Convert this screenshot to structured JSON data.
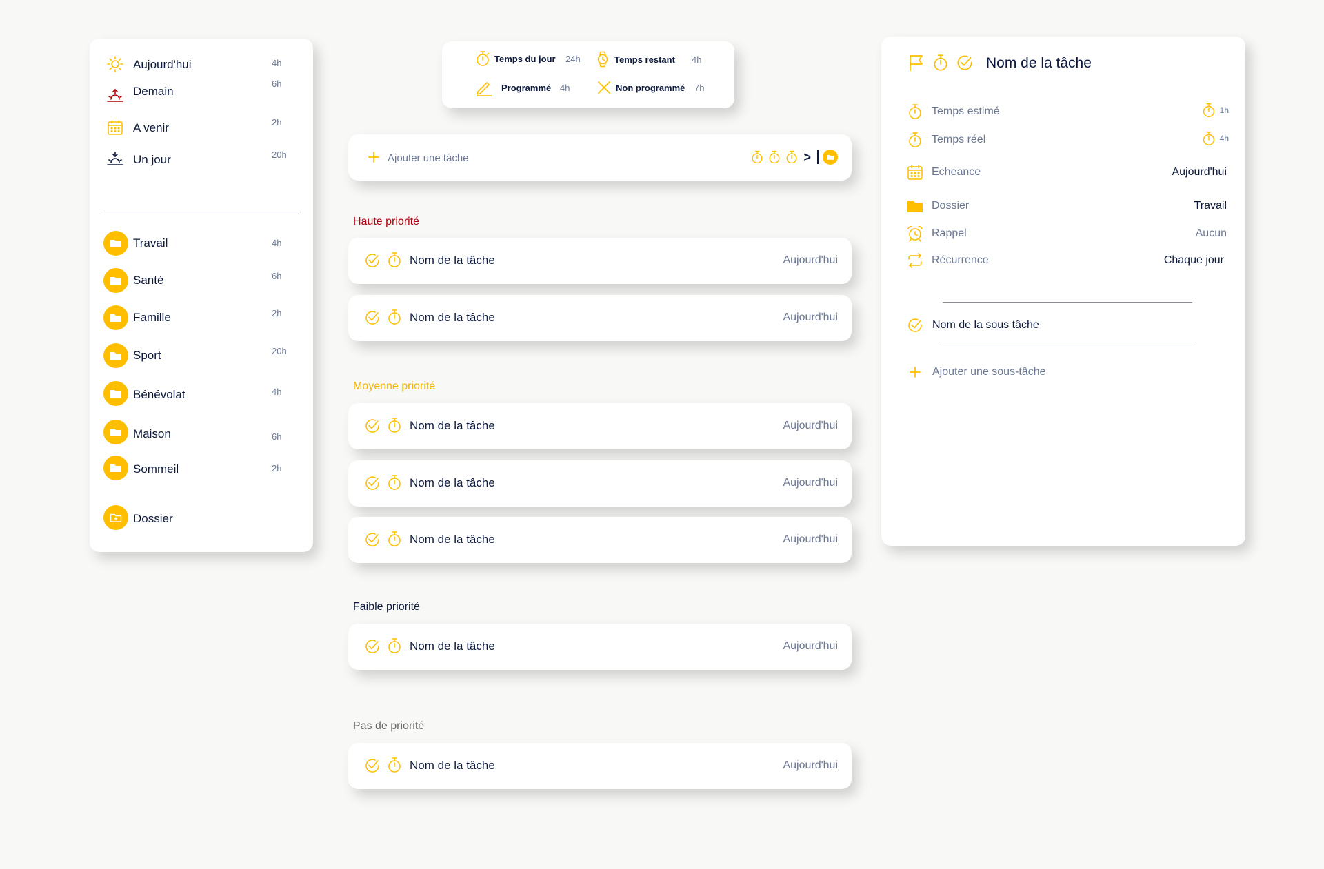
{
  "colors": {
    "accent": "#ffbf00",
    "text": "#0e1a3d",
    "muted": "#6c7894",
    "high_priority": "#b3000c",
    "medium_priority": "#f5b400",
    "low_priority": "#0e1a3d",
    "no_priority": "#6c6c6c"
  },
  "sidebar": {
    "views": [
      {
        "label": "Aujourd'hui",
        "hours": "4h",
        "icon": "sun-icon"
      },
      {
        "label": "Demain",
        "hours": "6h",
        "icon": "sunrise-icon"
      },
      {
        "label": "A venir",
        "hours": "2h",
        "icon": "calendar-icon"
      },
      {
        "label": "Un jour",
        "hours": "20h",
        "icon": "sunset-icon"
      }
    ],
    "folders": [
      {
        "label": "Travail",
        "hours": "4h"
      },
      {
        "label": "Santé",
        "hours": "6h"
      },
      {
        "label": "Famille",
        "hours": "2h"
      },
      {
        "label": "Sport",
        "hours": "20h"
      },
      {
        "label": "Bénévolat",
        "hours": "4h"
      },
      {
        "label": "Maison",
        "hours": "6h"
      },
      {
        "label": "Sommeil",
        "hours": "2h"
      }
    ],
    "add_folder_label": "Dossier"
  },
  "stats": {
    "day_time": {
      "label": "Temps du jour",
      "value": "24h"
    },
    "remaining": {
      "label": "Temps restant",
      "value": "4h"
    },
    "scheduled": {
      "label": "Programmé",
      "value": "4h"
    },
    "unscheduled": {
      "label": "Non programmé",
      "value": "7h"
    }
  },
  "add_task": {
    "placeholder": "Ajouter une tâche",
    "arrow": ">"
  },
  "sections": {
    "high": {
      "title": "Haute priorité",
      "tasks": [
        {
          "name": "Nom de la tâche",
          "date": "Aujourd'hui"
        },
        {
          "name": "Nom de la tâche",
          "date": "Aujourd'hui"
        }
      ]
    },
    "medium": {
      "title": "Moyenne priorité",
      "tasks": [
        {
          "name": "Nom de la tâche",
          "date": "Aujourd'hui"
        },
        {
          "name": "Nom de la tâche",
          "date": "Aujourd'hui"
        },
        {
          "name": "Nom de la tâche",
          "date": "Aujourd'hui"
        }
      ]
    },
    "low": {
      "title": "Faible priorité",
      "tasks": [
        {
          "name": "Nom de la tâche",
          "date": "Aujourd'hui"
        }
      ]
    },
    "none": {
      "title": "Pas de priorité",
      "tasks": [
        {
          "name": "Nom de la tâche",
          "date": "Aujourd'hui"
        }
      ]
    }
  },
  "detail": {
    "title": "Nom de la tâche",
    "estimated": {
      "label": "Temps estimé",
      "value": "1h"
    },
    "actual": {
      "label": "Temps réel",
      "value": "4h"
    },
    "deadline": {
      "label": "Echeance",
      "value": "Aujourd'hui"
    },
    "folder": {
      "label": "Dossier",
      "value": "Travail"
    },
    "reminder": {
      "label": "Rappel",
      "value": "Aucun"
    },
    "recurrence": {
      "label": "Récurrence",
      "value": "Chaque jour"
    },
    "subtask": "Nom de la sous tâche",
    "add_subtask": "Ajouter une sous-tâche"
  }
}
